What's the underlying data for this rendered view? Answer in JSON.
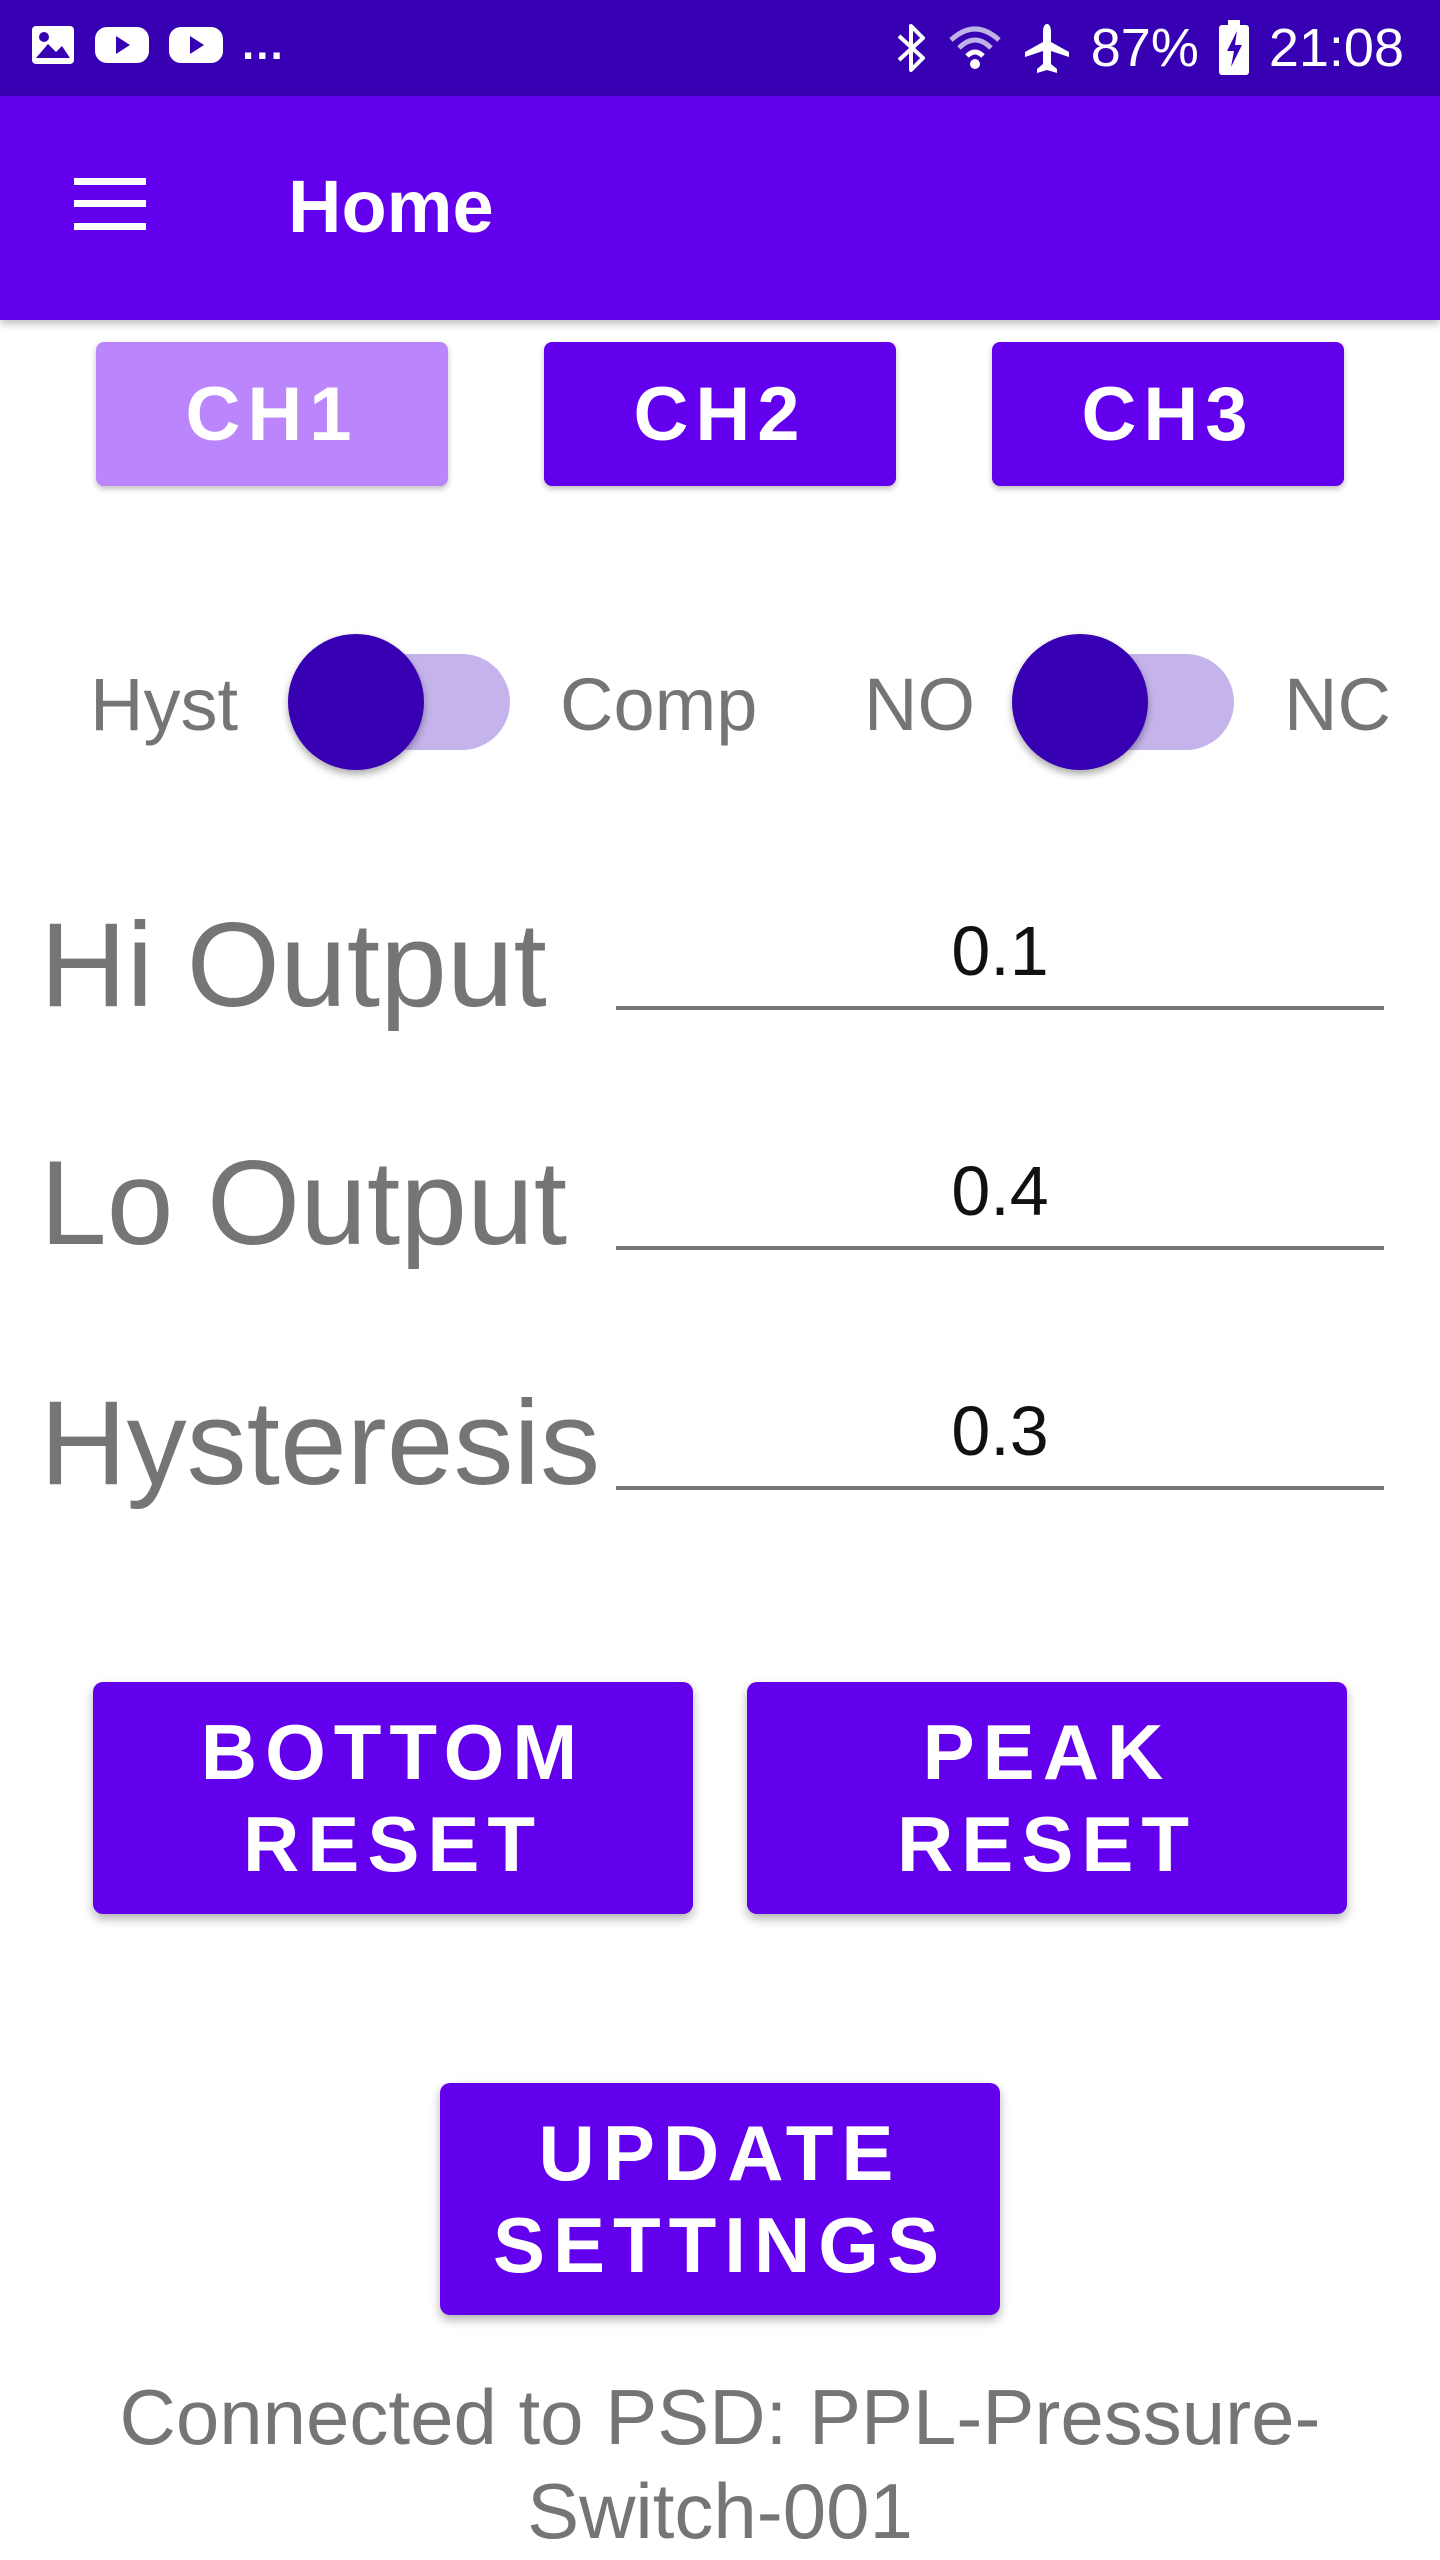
{
  "status_bar": {
    "left_icons": [
      "image-notification-icon",
      "youtube-icon",
      "youtube-icon"
    ],
    "overflow": "...",
    "right_icons": [
      "bluetooth-icon",
      "wifi-icon",
      "airplane-icon"
    ],
    "battery": "87%",
    "time": "21:08"
  },
  "app_bar": {
    "title": "Home"
  },
  "channels": [
    {
      "label": "CH1",
      "selected": true
    },
    {
      "label": "CH2",
      "selected": false
    },
    {
      "label": "CH3",
      "selected": false
    }
  ],
  "toggles": {
    "mode": {
      "left": "Hyst",
      "right": "Comp",
      "on": false
    },
    "contact": {
      "left": "NO",
      "right": "NC",
      "on": false
    }
  },
  "fields": {
    "hi_output": {
      "label": "Hi Output",
      "value": "0.1"
    },
    "lo_output": {
      "label": "Lo Output",
      "value": "0.4"
    },
    "hysteresis": {
      "label": "Hysteresis",
      "value": "0.3"
    }
  },
  "buttons": {
    "bottom_reset": [
      "BOTTOM",
      "RESET"
    ],
    "peak_reset": [
      "PEAK",
      "RESET"
    ],
    "update_settings": [
      "UPDATE",
      "SETTINGS"
    ]
  },
  "connection": {
    "line1": "Connected to PSD: PPL-Pressure-",
    "line2": "Switch-001"
  },
  "colors": {
    "primary": "#6200ee",
    "primary_dark": "#3700b3",
    "selected_channel": "#bb86fc",
    "switch_track": "#c5b4ec",
    "text_secondary": "#757575"
  }
}
